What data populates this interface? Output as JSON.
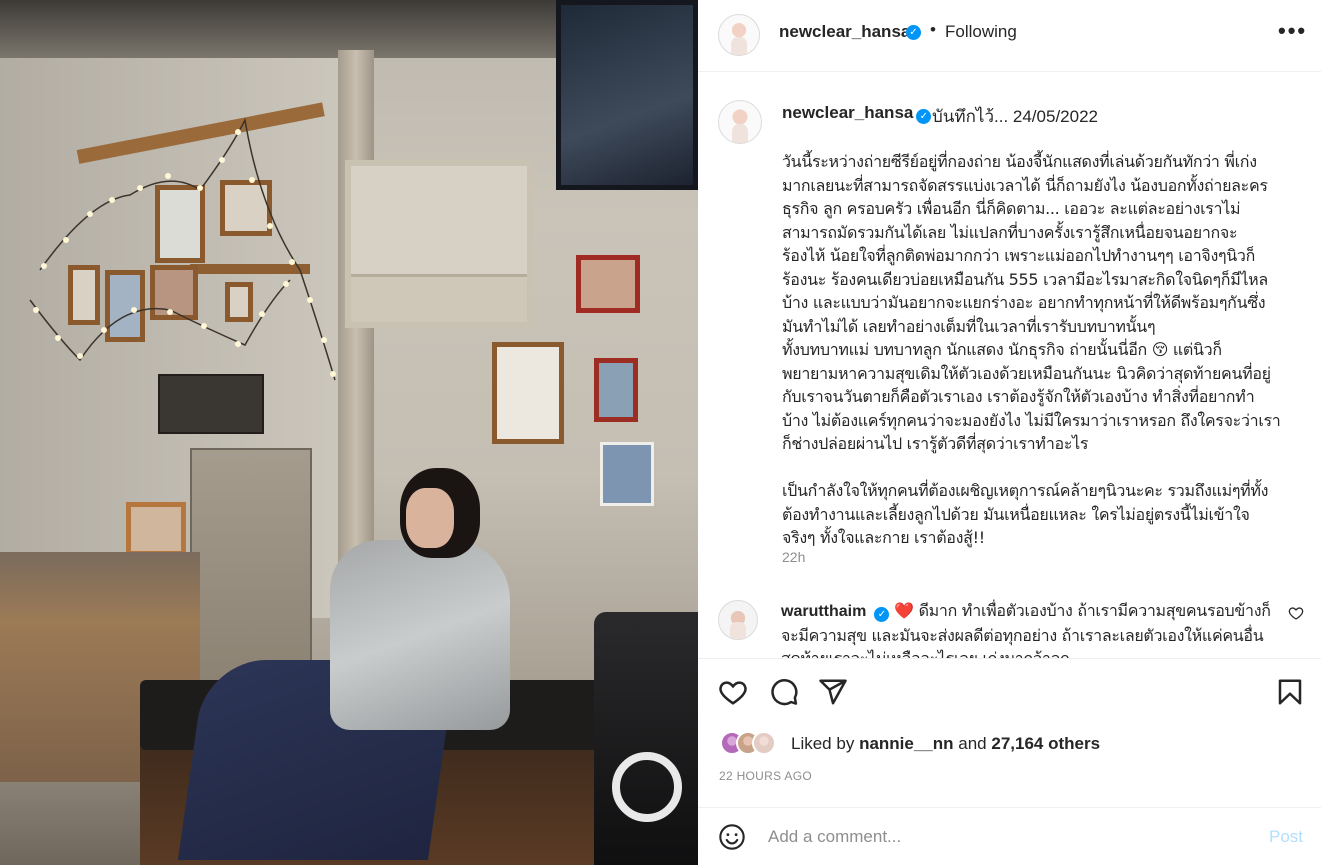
{
  "post_image": {
    "icon": "photo-of-woman-resting-on-bench"
  },
  "header": {
    "username": "newclear_hansa",
    "verified_icon": "verified-badge-icon",
    "separator": "•",
    "follow_status": "Following",
    "more_icon": "more-options-icon",
    "more_label": "•••"
  },
  "caption": {
    "username": "newclear_hansa",
    "title": "บันทึกไว้... 24/05/2022",
    "body": "วันนี้ระหว่างถ่ายซีรีย์อยู่ที่กองถ่าย น้องจี้นักแสดงที่เล่นด้วยกันทักว่า พี่เก่ง\nมากเลยนะที่สามารถจัดสรรแบ่งเวลาได้ นี่ก็ถามยังไง น้องบอกทั้งถ่ายละคร\nธุรกิจ ลูก ครอบครัว เพื่อนอีก นี่ก็คิดตาม... เออวะ ละแต่ละอย่างเราไม่\nสามารถมัดรวมกันได้เลย ไม่แปลกที่บางครั้งเรารู้สึกเหนื่อยจนอยากจะ\nร้องไห้ น้อยใจที่ลูกติดพ่อมากกว่า เพราะแม่ออกไปทำงานๆๆ เอาจิงๆนิวก็\nร้องนะ ร้องคนเดียวบ่อยเหมือนกัน 555 เวลามีอะไรมาสะกิดใจนิดๆก็มีไหล\nบ้าง และแบบว่ามันอยากจะแยกร่างอะ อยากทำทุกหน้าที่ให้ดีพร้อมๆกันซึ่ง\nมันทำไม่ได้ เลยทำอย่างเต็มที่ในเวลาที่เรารับบทบาทนั้นๆ\nทั้งบทบาทแม่ บทบาทลูก นักแสดง นักธุรกิจ ถ่ายนั้นนี่อีก 😚 แต่นิวก็\nพยายามหาความสุขเดิมให้ตัวเองด้วยเหมือนกันนะ นิวคิดว่าสุดท้ายคนที่อยู่\nกับเราจนวันตายก็คือตัวเราเอง เราต้องรู้จักให้ตัวเองบ้าง ทำสิ่งที่อยากทำ\nบ้าง ไม่ต้องแคร์ทุกคนว่าจะมองยังไง ไม่มีใครมาว่าเราหรอก ถึงใครจะว่าเรา\nก็ช่างปล่อยผ่านไป เรารู้ตัวดีที่สุดว่าเราทำอะไร\n\nเป็นกำลังใจให้ทุกคนที่ต้องเผชิญเหตุการณ์คล้ายๆนิวนะคะ รวมถึงแม่ๆที่ทั้ง\nต้องทำงานและเลี้ยงลูกไปด้วย มันเหนื่อยแหละ ใครไม่อยู่ตรงนี้ไม่เข้าใจ\nจริงๆ ทั้งใจและกาย เราต้องสู้!!",
    "time": "22h"
  },
  "comment": {
    "username": "warutthaim",
    "heart": "❤️",
    "text": "ดีมาก ทำเพื่อตัวเองบ้าง ถ้าเรามีความสุขคนรอบข้างก็จะมีความสุข และมันจะส่งผลดีต่อทุกอย่าง ถ้าเราละเลยตัวเองให้แค่คนอื่น สุดท้ายเราจะไม่เหลืออะไรเลย เก่งมากจ้าลูก",
    "like_icon": "heart-outline-icon"
  },
  "actions": {
    "like_icon": "heart-icon",
    "comment_icon": "comment-icon",
    "share_icon": "share-icon",
    "save_icon": "bookmark-icon"
  },
  "likes": {
    "prefix": "Liked by",
    "user": "nannie__nn",
    "conjunction": "and",
    "count": "27,164 others"
  },
  "posted": "22 HOURS AGO",
  "add_comment": {
    "emoji_icon": "emoji-icon",
    "placeholder": "Add a comment...",
    "post_label": "Post"
  }
}
